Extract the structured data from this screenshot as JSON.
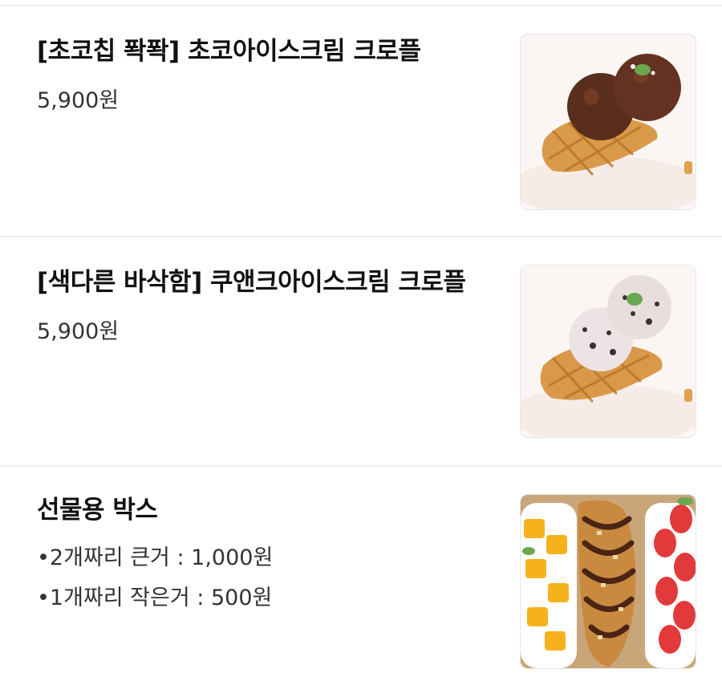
{
  "menu_items": [
    {
      "name": "[초코칩 퐉퐉] 초코아이스크림 크로플",
      "price": "5,900원",
      "image": "chocolate-ice-cream-croffle-photo"
    },
    {
      "name": "[색다른 바삭함] 쿠앤크아이스크림 크로플",
      "price": "5,900원",
      "image": "cookies-cream-ice-cream-croffle-photo"
    },
    {
      "name": "선물용 박스",
      "options": [
        "•2개짜리 큰거 : 1,000원",
        "•1개짜리 작은거 : 500원"
      ],
      "image": "croffle-gift-box-photo"
    }
  ]
}
